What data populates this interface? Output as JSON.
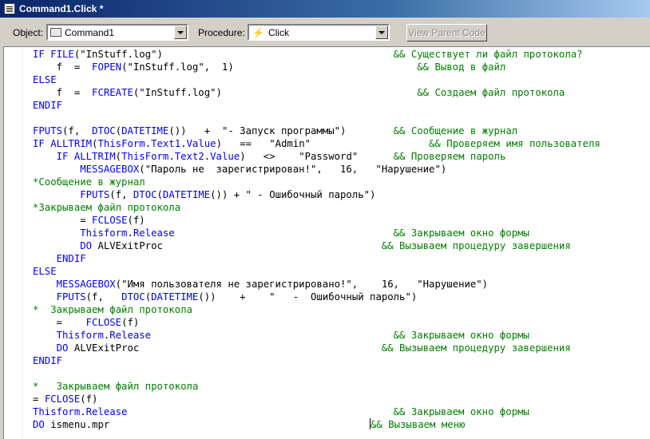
{
  "window": {
    "title": "Command1.Click *"
  },
  "toolbar": {
    "object_label": "Object:",
    "object_value": "Command1",
    "procedure_label": "Procedure:",
    "procedure_value": "Click",
    "view_parent_label": "View Parent Code"
  },
  "colors": {
    "keyword": "#0000ff",
    "comment": "#008000",
    "titlebar": "#0a246a"
  },
  "code": [
    [
      [
        "kw",
        "IF "
      ],
      [
        "fn",
        "FILE"
      ],
      [
        "t",
        "(\"InStuff.log\")"
      ],
      [
        "t",
        "                                       "
      ],
      [
        "cm",
        "&& Существует ли файл протокола?"
      ]
    ],
    [
      [
        "t",
        "    f  =  "
      ],
      [
        "fn",
        "FOPEN"
      ],
      [
        "t",
        "(\"InStuff.log\",  1)"
      ],
      [
        "t",
        "                               "
      ],
      [
        "cm",
        "&& Вывод в файл"
      ]
    ],
    [
      [
        "kw",
        "ELSE"
      ]
    ],
    [
      [
        "t",
        "    f  =  "
      ],
      [
        "fn",
        "FCREATE"
      ],
      [
        "t",
        "(\"InStuff.log\")"
      ],
      [
        "t",
        "                                 "
      ],
      [
        "cm",
        "&& Создаем файл протокола"
      ]
    ],
    [
      [
        "kw",
        "ENDIF"
      ]
    ],
    [],
    [
      [
        "fn",
        "FPUTS"
      ],
      [
        "t",
        "(f,  "
      ],
      [
        "fn",
        "DTOC"
      ],
      [
        "t",
        "("
      ],
      [
        "fn",
        "DATETIME"
      ],
      [
        "t",
        "())   +  \"- Запуск программы\")        "
      ],
      [
        "cm",
        "&& Сообщение в журнал"
      ]
    ],
    [
      [
        "kw",
        "IF "
      ],
      [
        "fn",
        "ALLTRIM"
      ],
      [
        "t",
        "("
      ],
      [
        "fn",
        "ThisForm"
      ],
      [
        "t",
        "."
      ],
      [
        "fn",
        "Text1"
      ],
      [
        "t",
        "."
      ],
      [
        "fn",
        "Value"
      ],
      [
        "t",
        ")   ==   \"Admin\"                    "
      ],
      [
        "cm",
        "&& Проверяем имя пользователя"
      ]
    ],
    [
      [
        "t",
        "    "
      ],
      [
        "kw",
        "IF "
      ],
      [
        "fn",
        "ALLTRIM"
      ],
      [
        "t",
        "("
      ],
      [
        "fn",
        "ThisForm"
      ],
      [
        "t",
        "."
      ],
      [
        "fn",
        "Text2"
      ],
      [
        "t",
        "."
      ],
      [
        "fn",
        "Value"
      ],
      [
        "t",
        ")   <>    \"Password\"      "
      ],
      [
        "cm",
        "&& Проверяем пароль"
      ]
    ],
    [
      [
        "t",
        "        "
      ],
      [
        "fn",
        "MESSAGEBOX"
      ],
      [
        "t",
        "(\"Пароль не  зарегистрирован!\",   16,   \"Нарушение\")"
      ]
    ],
    [
      [
        "cm",
        "*Сообщение в журнал"
      ]
    ],
    [
      [
        "t",
        "        "
      ],
      [
        "fn",
        "FPUTS"
      ],
      [
        "t",
        "(f, "
      ],
      [
        "fn",
        "DTOC"
      ],
      [
        "t",
        "("
      ],
      [
        "fn",
        "DATETIME"
      ],
      [
        "t",
        "()) + \" - Ошибочный пароль\")"
      ]
    ],
    [
      [
        "cm",
        "*Закрываем файл протокола"
      ]
    ],
    [
      [
        "t",
        "        = "
      ],
      [
        "fn",
        "FCLOSE"
      ],
      [
        "t",
        "(f)"
      ]
    ],
    [
      [
        "t",
        "        "
      ],
      [
        "fn",
        "Thisform"
      ],
      [
        "t",
        "."
      ],
      [
        "fn",
        "Release"
      ],
      [
        "t",
        "                                     "
      ],
      [
        "cm",
        "&& Закрываем окно формы"
      ]
    ],
    [
      [
        "t",
        "        "
      ],
      [
        "kw",
        "DO "
      ],
      [
        "t",
        "ALVExitProc                                     "
      ],
      [
        "cm",
        "&& Вызываем процедуру завершения"
      ]
    ],
    [
      [
        "t",
        "    "
      ],
      [
        "kw",
        "ENDIF"
      ]
    ],
    [
      [
        "kw",
        "ELSE"
      ]
    ],
    [
      [
        "t",
        "    "
      ],
      [
        "fn",
        "MESSAGEBOX"
      ],
      [
        "t",
        "(\"Имя пользователя не зарегистрировано!\",    16,   \"Нарушение\")"
      ]
    ],
    [
      [
        "t",
        "    "
      ],
      [
        "fn",
        "FPUTS"
      ],
      [
        "t",
        "(f,   "
      ],
      [
        "fn",
        "DTOC"
      ],
      [
        "t",
        "("
      ],
      [
        "fn",
        "DATETIME"
      ],
      [
        "t",
        "())    +    \"   -  Ошибочный пароль\")"
      ]
    ],
    [
      [
        "cm",
        "*  Закрываем файл протокола"
      ]
    ],
    [
      [
        "t",
        "    =    "
      ],
      [
        "fn",
        "FCLOSE"
      ],
      [
        "t",
        "(f)"
      ]
    ],
    [
      [
        "t",
        "    "
      ],
      [
        "fn",
        "Thisform"
      ],
      [
        "t",
        "."
      ],
      [
        "fn",
        "Release"
      ],
      [
        "t",
        "                                         "
      ],
      [
        "cm",
        "&& Закрываем окно формы"
      ]
    ],
    [
      [
        "t",
        "    "
      ],
      [
        "kw",
        "DO "
      ],
      [
        "t",
        "ALVExitProc                                         "
      ],
      [
        "cm",
        "&& Вызываем процедуру завершения"
      ]
    ],
    [
      [
        "kw",
        "ENDIF"
      ]
    ],
    [],
    [
      [
        "cm",
        "*   Закрываем файл протокола"
      ]
    ],
    [
      [
        "t",
        "= "
      ],
      [
        "fn",
        "FCLOSE"
      ],
      [
        "t",
        "(f)"
      ]
    ],
    [
      [
        "fn",
        "Thisform"
      ],
      [
        "t",
        "."
      ],
      [
        "fn",
        "Release"
      ],
      [
        "t",
        "                                             "
      ],
      [
        "cm",
        "&& Закрываем окно формы"
      ]
    ],
    [
      [
        "kw",
        "DO "
      ],
      [
        "t",
        "ismenu.mpr                                            "
      ],
      [
        "caret",
        ""
      ],
      [
        "cm",
        "&& Вызываем меню"
      ]
    ]
  ]
}
